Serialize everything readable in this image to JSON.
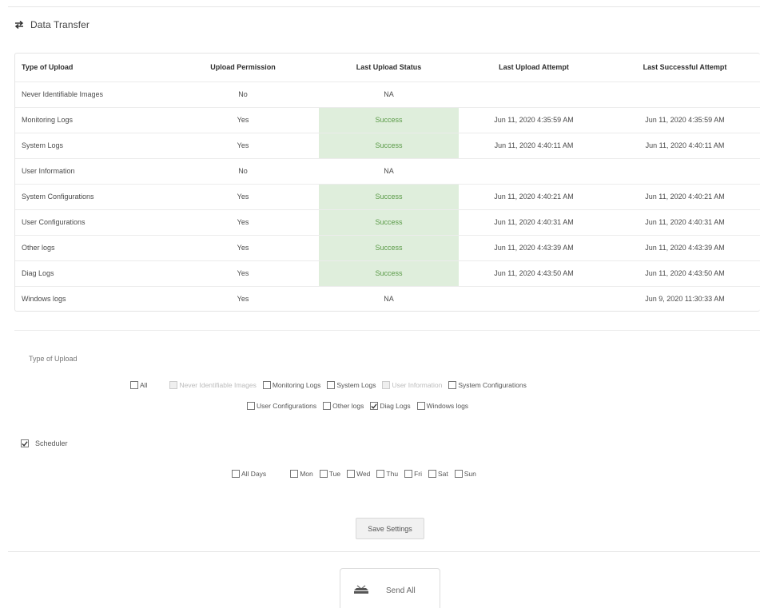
{
  "header": {
    "title": "Data Transfer",
    "icon": "transfer-arrows-icon"
  },
  "table": {
    "columns": [
      "Type of Upload",
      "Upload Permission",
      "Last Upload Status",
      "Last Upload Attempt",
      "Last Successful Attempt"
    ],
    "rows": [
      [
        "Never Identifiable Images",
        "No",
        "NA",
        "",
        ""
      ],
      [
        "Monitoring Logs",
        "Yes",
        "Success",
        "Jun 11, 2020 4:35:59 AM",
        "Jun 11, 2020 4:35:59 AM"
      ],
      [
        "System Logs",
        "Yes",
        "Success",
        "Jun 11, 2020 4:40:11 AM",
        "Jun 11, 2020 4:40:11 AM"
      ],
      [
        "User Information",
        "No",
        "NA",
        "",
        ""
      ],
      [
        "System Configurations",
        "Yes",
        "Success",
        "Jun 11, 2020 4:40:21 AM",
        "Jun 11, 2020 4:40:21 AM"
      ],
      [
        "User Configurations",
        "Yes",
        "Success",
        "Jun 11, 2020 4:40:31 AM",
        "Jun 11, 2020 4:40:31 AM"
      ],
      [
        "Other logs",
        "Yes",
        "Success",
        "Jun 11, 2020 4:43:39 AM",
        "Jun 11, 2020 4:43:39 AM"
      ],
      [
        "Diag Logs",
        "Yes",
        "Success",
        "Jun 11, 2020 4:43:50 AM",
        "Jun 11, 2020 4:43:50 AM"
      ],
      [
        "Windows logs",
        "Yes",
        "NA",
        "",
        "Jun 9, 2020 11:30:33 AM"
      ]
    ],
    "success_color": "#dfeedc"
  },
  "upload_types": {
    "label": "Type of Upload",
    "options": [
      {
        "label": "All",
        "checked": false,
        "disabled": false
      },
      {
        "label": "Never Identifiable Images",
        "checked": false,
        "disabled": true
      },
      {
        "label": "Monitoring Logs",
        "checked": false,
        "disabled": false
      },
      {
        "label": "System Logs",
        "checked": false,
        "disabled": false
      },
      {
        "label": "User Information",
        "checked": false,
        "disabled": true
      },
      {
        "label": "System Configurations",
        "checked": false,
        "disabled": false
      },
      {
        "label": "User Configurations",
        "checked": false,
        "disabled": false
      },
      {
        "label": "Other logs",
        "checked": false,
        "disabled": false
      },
      {
        "label": "Diag Logs",
        "checked": true,
        "disabled": false
      },
      {
        "label": "Windows logs",
        "checked": false,
        "disabled": false
      }
    ]
  },
  "scheduler": {
    "label": "Scheduler",
    "checked": true,
    "all_days": "All Days",
    "days": [
      "Mon",
      "Tue",
      "Wed",
      "Thu",
      "Fri",
      "Sat",
      "Sun"
    ]
  },
  "actions": {
    "save": "Save Settings",
    "send_all": "Send All",
    "send_icon": "upload-tray-icon"
  }
}
